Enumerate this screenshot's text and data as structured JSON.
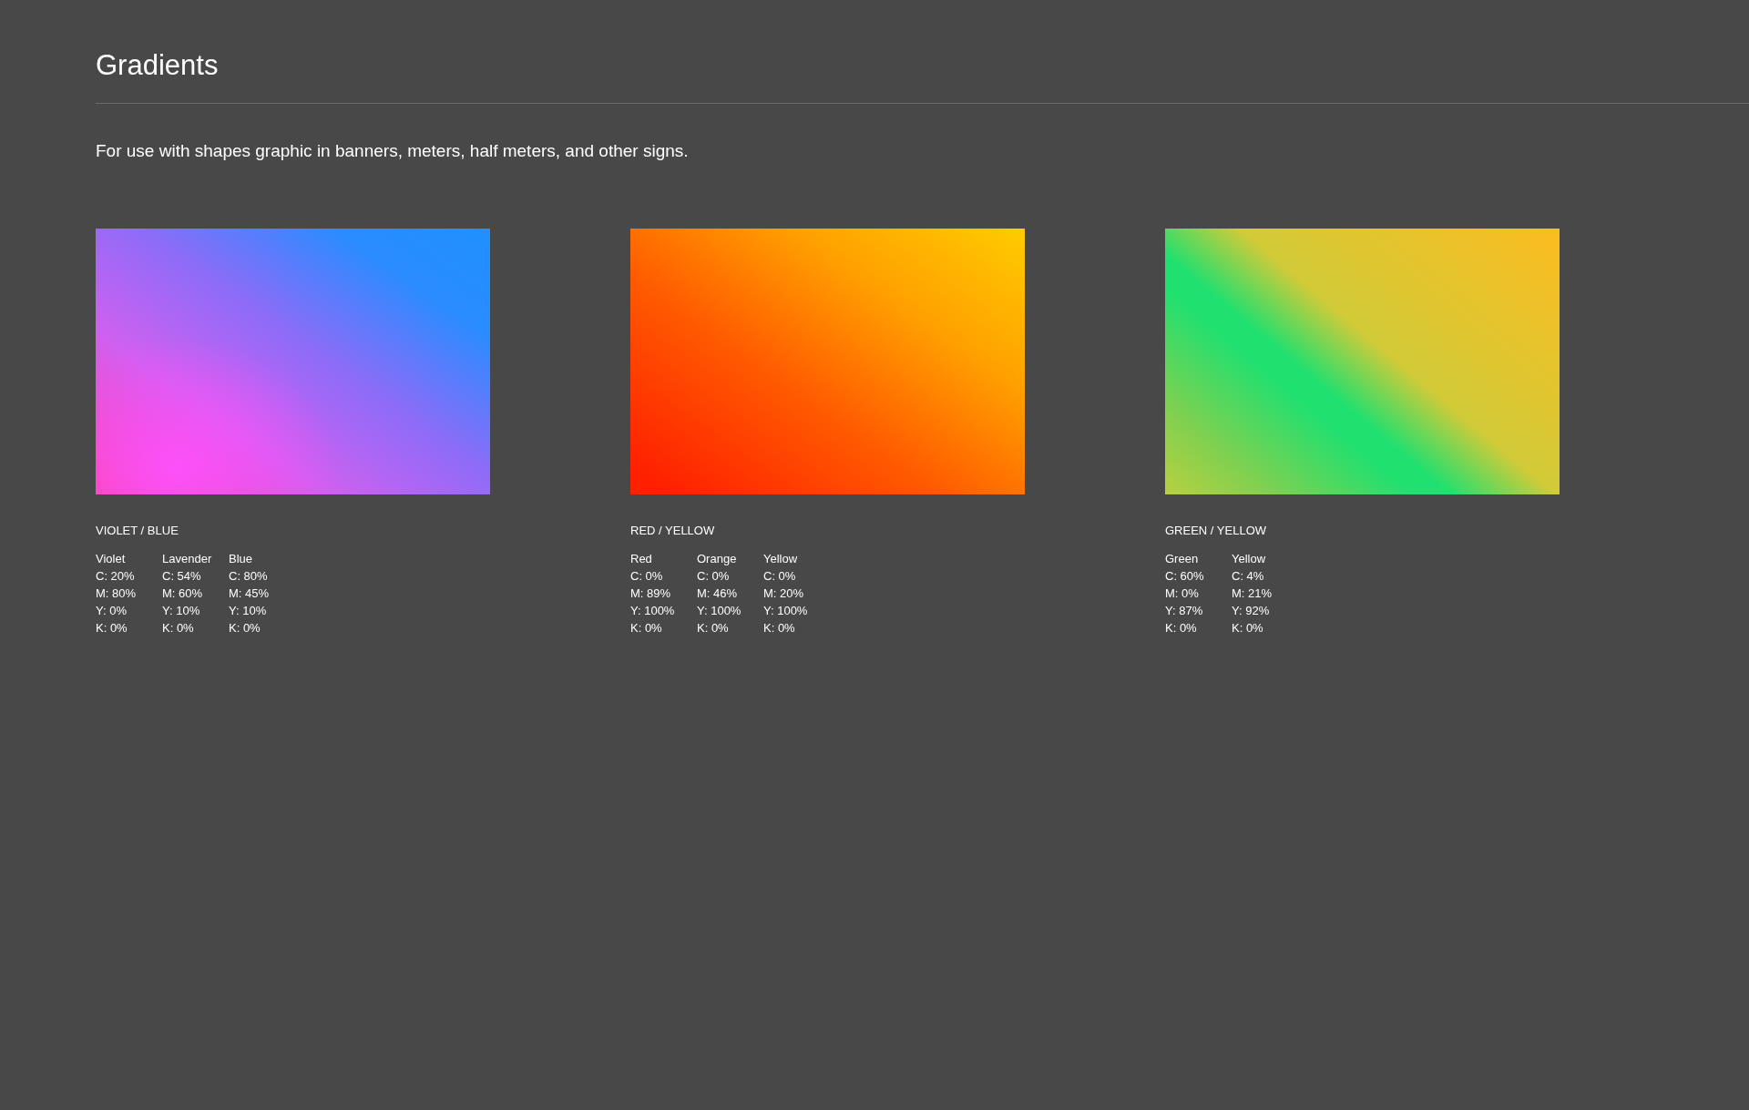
{
  "title": "Gradients",
  "description": "For use with shapes graphic in banners, meters, half meters, and other signs.",
  "gradients": [
    {
      "kind": "violet-blue",
      "label": "VIOLET / BLUE",
      "colors": [
        {
          "name": "Violet",
          "values": [
            "C: 20%",
            "M: 80%",
            "Y: 0%",
            "K: 0%"
          ]
        },
        {
          "name": "Lavender",
          "values": [
            "C: 54%",
            "M: 60%",
            "Y: 10%",
            "K: 0%"
          ]
        },
        {
          "name": "Blue",
          "values": [
            "C: 80%",
            "M: 45%",
            "Y: 10%",
            "K: 0%"
          ]
        }
      ]
    },
    {
      "kind": "red-yellow",
      "label": "RED / YELLOW",
      "colors": [
        {
          "name": "Red",
          "values": [
            "C: 0%",
            "M: 89%",
            "Y: 100%",
            "K: 0%"
          ]
        },
        {
          "name": "Orange",
          "values": [
            "C: 0%",
            "M: 46%",
            "Y: 100%",
            "K: 0%"
          ]
        },
        {
          "name": "Yellow",
          "values": [
            "C: 0%",
            "M: 20%",
            "Y: 100%",
            "K: 0%"
          ]
        }
      ]
    },
    {
      "kind": "green-yellow",
      "label": "GREEN / YELLOW",
      "colors": [
        {
          "name": "Green",
          "values": [
            "C: 60%",
            "M: 0%",
            "Y: 87%",
            "K: 0%"
          ]
        },
        {
          "name": "Yellow",
          "values": [
            "C: 4%",
            "M: 21%",
            "Y: 92%",
            "K: 0%"
          ]
        }
      ]
    }
  ]
}
